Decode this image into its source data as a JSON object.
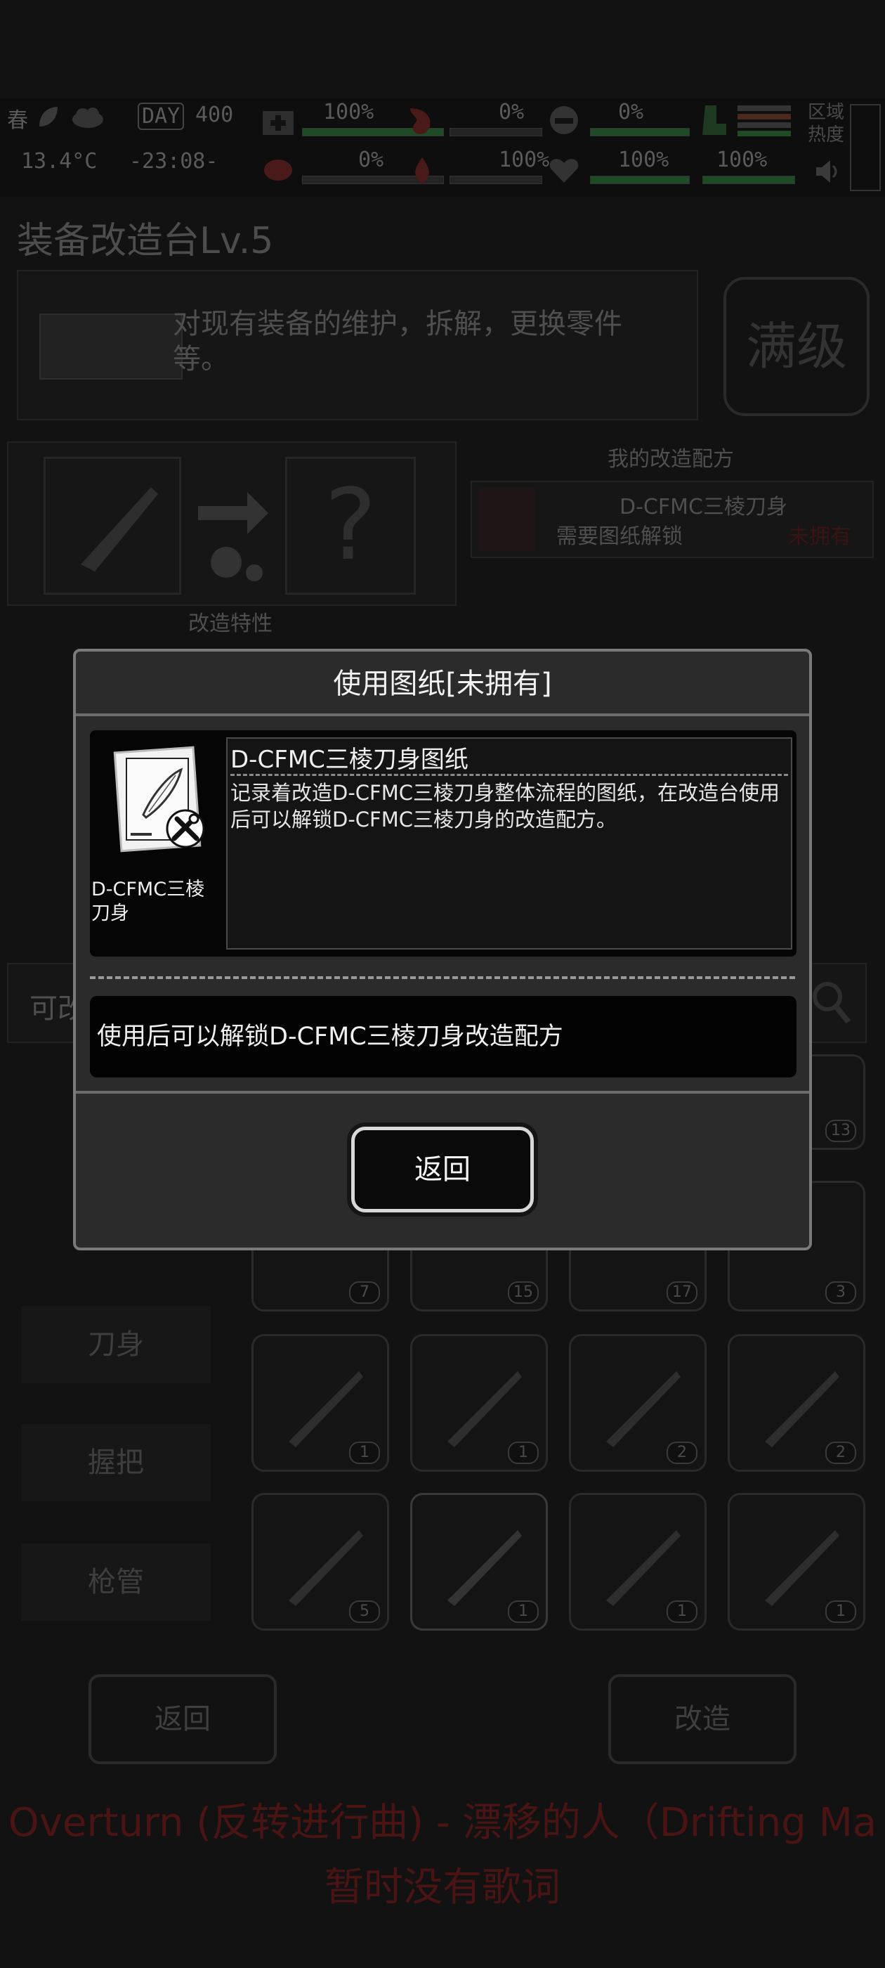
{
  "hud": {
    "season": "春",
    "day_label": "DAY",
    "day_value": "400",
    "temperature": "13.4°C",
    "clock": "-23:08-",
    "stats_row1": [
      "100%",
      "0%",
      "100%"
    ],
    "stats_row2": [
      "0%",
      "0%",
      "100%",
      "100%"
    ],
    "zone_label_1": "区域",
    "zone_label_2": "热度"
  },
  "background": {
    "page_title": "装备改造台Lv.5",
    "description": "对现有装备的维护，拆解，更换零件等。",
    "max_level_badge": "满级",
    "my_recipes_header": "我的改造配方",
    "recipe_name": "D-CFMC三棱刀身",
    "recipe_requirement": "需要图纸解锁",
    "recipe_status": "未拥有",
    "mod_traits_label": "改造特性",
    "search_placeholder": "可改",
    "categories": [
      "刀身",
      "握把",
      "枪管"
    ],
    "slot_counts": [
      "13",
      "7",
      "15",
      "17",
      "3",
      "1",
      "1",
      "2",
      "2",
      "5",
      "1",
      "1",
      "1"
    ],
    "back_button": "返回",
    "modify_button": "改造"
  },
  "lyrics": {
    "line1": "Overturn (反转进行曲) - 漂移的人（Drifting Ma",
    "line2": "暂时没有歌词"
  },
  "dialog": {
    "title": "使用图纸[未拥有]",
    "item_name": "D-CFMC三棱刀身",
    "desc_title": "D-CFMC三棱刀身图纸",
    "desc_body": "记录着改造D-CFMC三棱刀身整体流程的图纸，在改造台使用后可以解锁D-CFMC三棱刀身的改造配方。",
    "unlock_text": "使用后可以解锁D-CFMC三棱刀身改造配方",
    "back_button": "返回"
  },
  "colors": {
    "dialog_bg": "#2b2b2b",
    "dialog_border": "#7a7a7a",
    "lyric_color": "#4a1414",
    "hud_green": "#1f4a26"
  },
  "icons": [
    "leaf-icon",
    "cloud-icon",
    "medkit-icon",
    "stomach-icon",
    "helmet-icon",
    "heart-icon",
    "blood-drop-icon",
    "brain-icon",
    "boot-icon",
    "speaker-icon",
    "gear-icon",
    "arrow-right-icon",
    "question-icon",
    "blade-icon",
    "blueprint-icon",
    "wrench-hammer-icon"
  ]
}
